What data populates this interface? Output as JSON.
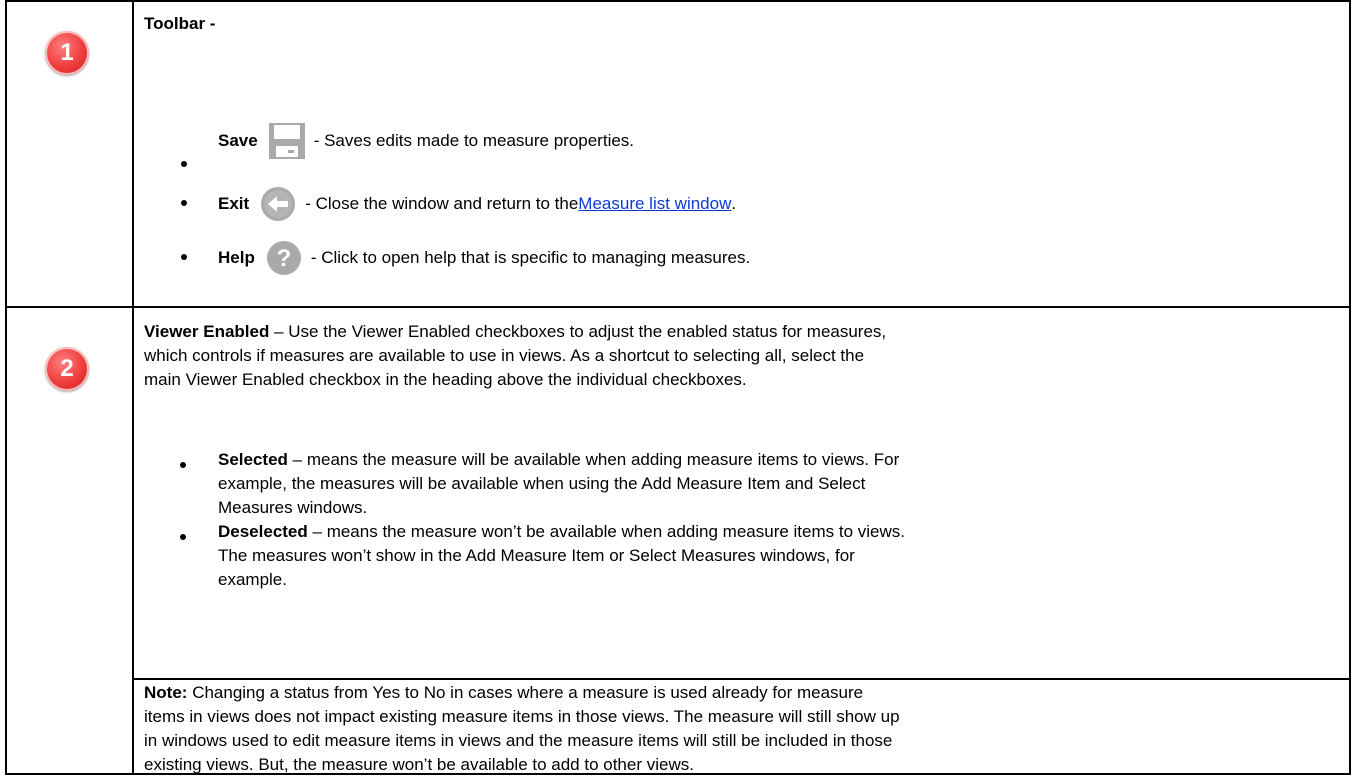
{
  "section1": {
    "badge": "1",
    "title": "Toolbar -",
    "items": [
      {
        "label": "Save",
        "icon": "save-icon",
        "text": "- Saves edits made to measure properties."
      },
      {
        "label": "Exit",
        "icon": "exit-back-arrow-icon",
        "text_before": "- Close the window and return to the ",
        "link": "Measure list window",
        "text_after": "."
      },
      {
        "label": "Help",
        "icon": "help-question-icon",
        "text": "- Click to open help that is specific to managing measures."
      }
    ]
  },
  "section2": {
    "badge": "2",
    "title": "Viewer Enabled",
    "intro_lines": [
      "– Use the Viewer Enabled checkboxes to adjust the enabled status for measures,",
      "which controls if measures are available to use in views. As a shortcut to selecting all, select the",
      "main Viewer Enabled checkbox in the heading above the individual checkboxes."
    ],
    "bullets": [
      {
        "label": "Selected",
        "lines": [
          "– means the measure will be available when adding measure items to views. For",
          "example, the measures will be available when using the Add Measure Item and Select",
          "Measures windows."
        ]
      },
      {
        "label": "Deselected",
        "lines": [
          "– means the measure won’t be available when adding measure items to views.",
          "The measures won’t show in the Add Measure Item or Select Measures windows, for",
          "example."
        ]
      }
    ],
    "note_label": "Note:",
    "note_lines": [
      "Changing a status from Yes to No in cases where a measure is used already for measure",
      "items in views does not impact existing measure items in those views. The measure will still show up",
      "in windows used to edit measure items in views and the measure items will still be included in those",
      "existing views. But, the measure won’t be available to add to other views."
    ]
  },
  "colors": {
    "badge_red": "#ee3a3a",
    "link_blue": "#0b3bd3",
    "icon_grey": "#a9a9a9"
  }
}
